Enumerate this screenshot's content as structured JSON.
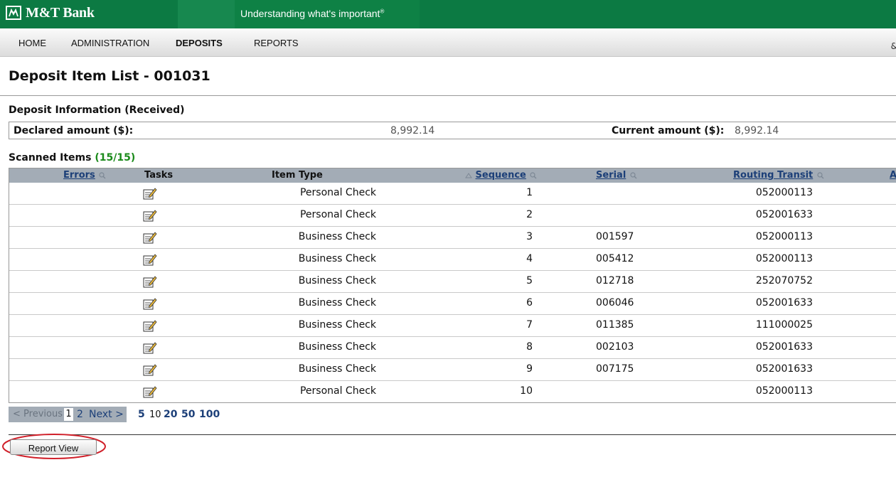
{
  "header": {
    "logo_text": "M&T Bank",
    "tagline": "Understanding what's important",
    "tagline_mark": "®"
  },
  "nav": {
    "items": [
      {
        "label": "HOME",
        "active": false
      },
      {
        "label": "ADMINISTRATION",
        "active": false
      },
      {
        "label": "DEPOSITS",
        "active": true
      },
      {
        "label": "REPORTS",
        "active": false
      }
    ],
    "tail": "&"
  },
  "page": {
    "title": "Deposit Item List - 001031"
  },
  "deposit_info": {
    "heading": "Deposit Information (Received)",
    "declared_label": "Declared amount ($):",
    "declared_value": "8,992.14",
    "current_label": "Current amount ($):",
    "current_value": "8,992.14"
  },
  "scanned": {
    "heading": "Scanned Items",
    "count": "(15/15)"
  },
  "table": {
    "headers": {
      "errors": "Errors",
      "tasks": "Tasks",
      "item_type": "Item Type",
      "sequence": "Sequence",
      "serial": "Serial",
      "routing": "Routing Transit",
      "next_col": "A"
    },
    "rows": [
      {
        "item_type": "Personal Check",
        "sequence": "1",
        "serial": "",
        "routing": "052000113"
      },
      {
        "item_type": "Personal Check",
        "sequence": "2",
        "serial": "",
        "routing": "052001633"
      },
      {
        "item_type": "Business Check",
        "sequence": "3",
        "serial": "001597",
        "routing": "052000113"
      },
      {
        "item_type": "Business Check",
        "sequence": "4",
        "serial": "005412",
        "routing": "052000113"
      },
      {
        "item_type": "Business Check",
        "sequence": "5",
        "serial": "012718",
        "routing": "252070752"
      },
      {
        "item_type": "Business Check",
        "sequence": "6",
        "serial": "006046",
        "routing": "052001633"
      },
      {
        "item_type": "Business Check",
        "sequence": "7",
        "serial": "011385",
        "routing": "111000025"
      },
      {
        "item_type": "Business Check",
        "sequence": "8",
        "serial": "002103",
        "routing": "052001633"
      },
      {
        "item_type": "Business Check",
        "sequence": "9",
        "serial": "007175",
        "routing": "052001633"
      },
      {
        "item_type": "Personal Check",
        "sequence": "10",
        "serial": "",
        "routing": "052000113"
      }
    ]
  },
  "pager": {
    "previous": "< Previous",
    "current_page": "1",
    "page_2": "2",
    "next": "Next >",
    "page_sizes": [
      "5",
      "10",
      "20",
      "50",
      "100"
    ],
    "current_size": "10"
  },
  "actions": {
    "report_view": "Report View"
  },
  "colors": {
    "brand_green": "#0c7a43",
    "table_header": "#a3acb6",
    "link_blue": "#1c3f78",
    "count_green": "#1a8a1a",
    "highlight_red": "#d0202a"
  }
}
